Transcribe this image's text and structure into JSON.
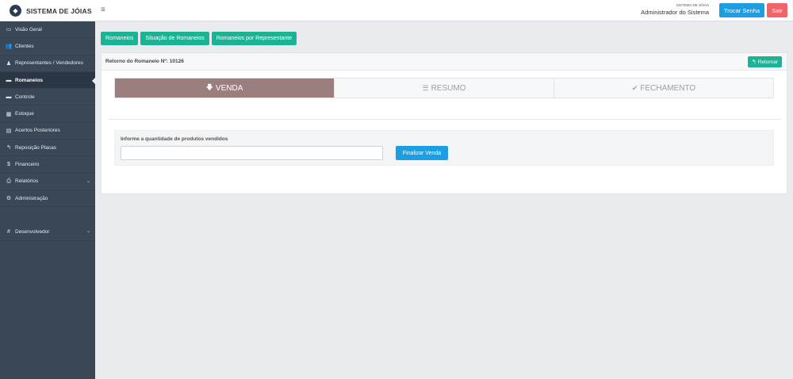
{
  "brand": {
    "name": "SISTEMA DE JÓIAS",
    "logo_icon": "diamond-icon"
  },
  "header": {
    "menu_icon": "≡",
    "app_name": "SISTEMA DE JÓIAS",
    "user_name": "Administrador do Sistema",
    "change_password_label": "Trocar Senha",
    "logout_label": "Sair"
  },
  "sidebar": {
    "items": [
      {
        "label": "Visão Geral",
        "icon": "▭"
      },
      {
        "label": "Clientes",
        "icon": "👥"
      },
      {
        "label": "Representantes / Vendedores",
        "icon": "♟"
      },
      {
        "label": "Romaneios",
        "icon": "▬"
      },
      {
        "label": "Controle",
        "icon": "▬"
      },
      {
        "label": "Estoque",
        "icon": "▦"
      },
      {
        "label": "Acertos Posteriores",
        "icon": "▤"
      },
      {
        "label": "Reposição Placas",
        "icon": "↰"
      },
      {
        "label": "Financeiro",
        "icon": "$"
      },
      {
        "label": "Relatórios",
        "icon": "⎙",
        "chevron": "⌄"
      },
      {
        "label": "Administração",
        "icon": "⚙"
      },
      {
        "label": "Desenvolvedor",
        "icon": "#",
        "chevron": "⌄"
      }
    ],
    "active_index": 3
  },
  "top_tabs": [
    {
      "label": "Romaneios"
    },
    {
      "label": "Situação de Romaneios"
    },
    {
      "label": "Romaneios por Representante"
    }
  ],
  "panel": {
    "title": "Retorno do Romaneio Nº: 10126",
    "back_label": "Retornar",
    "back_icon": "↰"
  },
  "steps": [
    {
      "label": "VENDA",
      "icon": "🡇",
      "active": true
    },
    {
      "label": "RESUMO",
      "icon": "☰",
      "active": false
    },
    {
      "label": "FECHAMENTO",
      "icon": "✔",
      "active": false
    }
  ],
  "form": {
    "label": "Informe a quantidade de produtos vendidos",
    "value": "",
    "placeholder": "",
    "submit_label": "Finalizar Venda"
  },
  "colors": {
    "sidebar_bg": "#3a4756",
    "accent_green": "#1bb394",
    "accent_blue": "#1e9ee2",
    "danger_red": "#f0646a",
    "step_active": "#9b7e7e"
  }
}
